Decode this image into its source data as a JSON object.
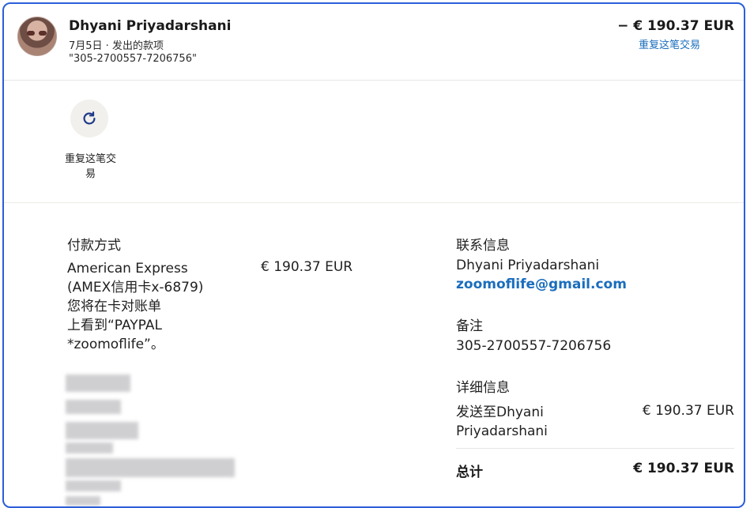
{
  "header": {
    "name": "Dhyani Priyadarshani",
    "meta": "7月5日 · 发出的款项",
    "reference": "\"305-2700557-7206756\"",
    "amount": "− € 190.37 EUR",
    "repeat_link": "重复这笔交易"
  },
  "actions": [
    {
      "label": "重复这笔交易",
      "icon": "refresh-icon"
    }
  ],
  "payment_method": {
    "heading": "付款方式",
    "lines": [
      "American Express",
      "(AMEX信用卡x-6879)",
      "您将在卡对账单",
      "上看到“PAYPAL",
      "*zoomoflife”。"
    ],
    "amount": "€ 190.37 EUR"
  },
  "contact": {
    "heading": "联系信息",
    "name": "Dhyani Priyadarshani",
    "email": "zoomoflife@gmail.com"
  },
  "note": {
    "heading": "备注",
    "value": "305-2700557-7206756"
  },
  "details": {
    "heading": "详细信息",
    "description_lines": [
      "发送至Dhyani",
      "Priyadarshani"
    ],
    "amount": "€ 190.37 EUR",
    "total_label": "总计",
    "total_amount": "€ 190.37 EUR"
  },
  "colors": {
    "border": "#2b5fd9",
    "link": "#1a6dbd",
    "action_bg": "#f1f0ec",
    "icon": "#1f3a8a"
  }
}
